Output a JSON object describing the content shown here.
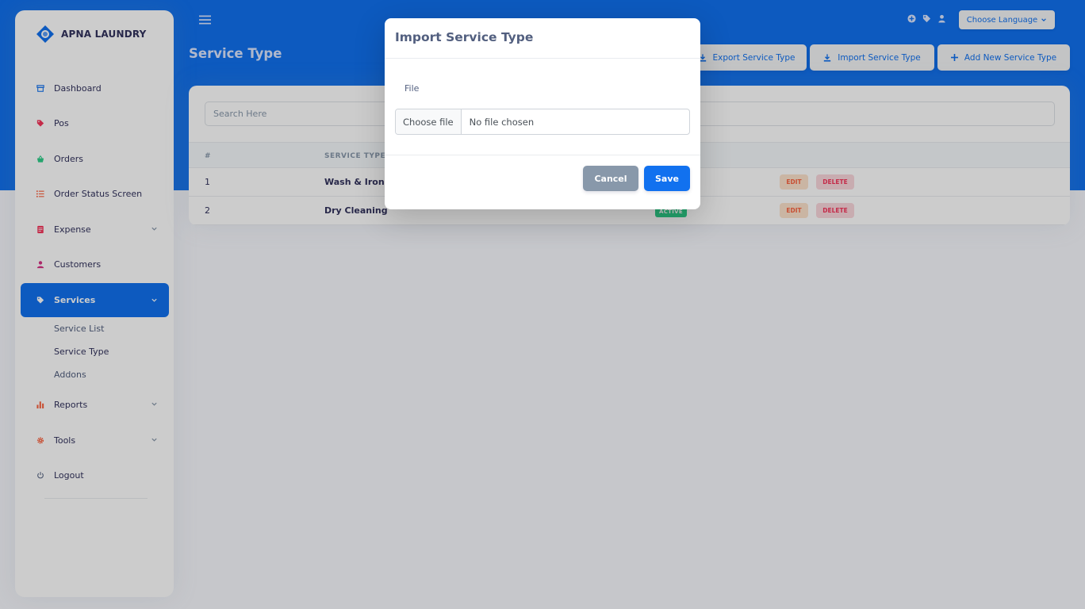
{
  "brand": {
    "name": "APNA LAUNDRY"
  },
  "sidebar": {
    "items": [
      {
        "label": "Dashboard",
        "icon": "shop-icon",
        "color": "#1171ef"
      },
      {
        "label": "Pos",
        "icon": "tag-icon",
        "color": "#f5365c"
      },
      {
        "label": "Orders",
        "icon": "basket-icon",
        "color": "#2dce89"
      },
      {
        "label": "Order Status Screen",
        "icon": "list-icon",
        "color": "#fb6340"
      },
      {
        "label": "Expense",
        "icon": "receipt-icon",
        "color": "#f5365c"
      },
      {
        "label": "Customers",
        "icon": "user-icon",
        "color": "#d63384"
      },
      {
        "label": "Services",
        "icon": "tag-icon",
        "color": "#ffffff"
      },
      {
        "label": "Reports",
        "icon": "chart-bar-icon",
        "color": "#fb6340"
      },
      {
        "label": "Tools",
        "icon": "gear-icon",
        "color": "#fb6340"
      },
      {
        "label": "Logout",
        "icon": "power-icon",
        "color": "#525f7f"
      }
    ],
    "services_submenu": [
      "Service List",
      "Service Type",
      "Addons"
    ]
  },
  "header": {
    "title": "Service Type",
    "language_label": "Choose Language",
    "export_label": "Export Service Type",
    "import_label": "Import Service Type",
    "add_label": "Add New Service Type"
  },
  "table": {
    "search_placeholder": "Search Here",
    "columns": [
      "#",
      "SERVICE TYPE"
    ],
    "rows": [
      {
        "index": "1",
        "name": "Wash & Iron",
        "edit": "EDIT",
        "delete": "DELETE"
      },
      {
        "index": "2",
        "name": "Dry Cleaning",
        "status": "ACTIVE",
        "edit": "EDIT",
        "delete": "DELETE"
      }
    ]
  },
  "modal": {
    "title": "Import Service Type",
    "field_label": "File",
    "choose_file": "Choose file",
    "no_file": "No file chosen",
    "cancel": "Cancel",
    "save": "Save"
  },
  "colors": {
    "primary": "#1171ef",
    "success": "#2dce89",
    "danger": "#f5365c",
    "warning": "#fb6340"
  }
}
